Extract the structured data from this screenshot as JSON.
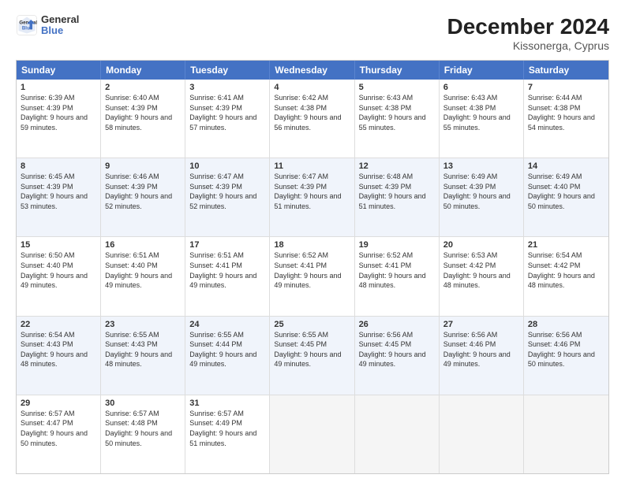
{
  "logo": {
    "line1": "General",
    "line2": "Blue"
  },
  "title": "December 2024",
  "subtitle": "Kissonerga, Cyprus",
  "days": [
    "Sunday",
    "Monday",
    "Tuesday",
    "Wednesday",
    "Thursday",
    "Friday",
    "Saturday"
  ],
  "weeks": [
    [
      {
        "num": "1",
        "sunrise": "6:39 AM",
        "sunset": "4:39 PM",
        "daylight": "9 hours and 59 minutes."
      },
      {
        "num": "2",
        "sunrise": "6:40 AM",
        "sunset": "4:39 PM",
        "daylight": "9 hours and 58 minutes."
      },
      {
        "num": "3",
        "sunrise": "6:41 AM",
        "sunset": "4:39 PM",
        "daylight": "9 hours and 57 minutes."
      },
      {
        "num": "4",
        "sunrise": "6:42 AM",
        "sunset": "4:38 PM",
        "daylight": "9 hours and 56 minutes."
      },
      {
        "num": "5",
        "sunrise": "6:43 AM",
        "sunset": "4:38 PM",
        "daylight": "9 hours and 55 minutes."
      },
      {
        "num": "6",
        "sunrise": "6:43 AM",
        "sunset": "4:38 PM",
        "daylight": "9 hours and 55 minutes."
      },
      {
        "num": "7",
        "sunrise": "6:44 AM",
        "sunset": "4:38 PM",
        "daylight": "9 hours and 54 minutes."
      }
    ],
    [
      {
        "num": "8",
        "sunrise": "6:45 AM",
        "sunset": "4:39 PM",
        "daylight": "9 hours and 53 minutes."
      },
      {
        "num": "9",
        "sunrise": "6:46 AM",
        "sunset": "4:39 PM",
        "daylight": "9 hours and 52 minutes."
      },
      {
        "num": "10",
        "sunrise": "6:47 AM",
        "sunset": "4:39 PM",
        "daylight": "9 hours and 52 minutes."
      },
      {
        "num": "11",
        "sunrise": "6:47 AM",
        "sunset": "4:39 PM",
        "daylight": "9 hours and 51 minutes."
      },
      {
        "num": "12",
        "sunrise": "6:48 AM",
        "sunset": "4:39 PM",
        "daylight": "9 hours and 51 minutes."
      },
      {
        "num": "13",
        "sunrise": "6:49 AM",
        "sunset": "4:39 PM",
        "daylight": "9 hours and 50 minutes."
      },
      {
        "num": "14",
        "sunrise": "6:49 AM",
        "sunset": "4:40 PM",
        "daylight": "9 hours and 50 minutes."
      }
    ],
    [
      {
        "num": "15",
        "sunrise": "6:50 AM",
        "sunset": "4:40 PM",
        "daylight": "9 hours and 49 minutes."
      },
      {
        "num": "16",
        "sunrise": "6:51 AM",
        "sunset": "4:40 PM",
        "daylight": "9 hours and 49 minutes."
      },
      {
        "num": "17",
        "sunrise": "6:51 AM",
        "sunset": "4:41 PM",
        "daylight": "9 hours and 49 minutes."
      },
      {
        "num": "18",
        "sunrise": "6:52 AM",
        "sunset": "4:41 PM",
        "daylight": "9 hours and 49 minutes."
      },
      {
        "num": "19",
        "sunrise": "6:52 AM",
        "sunset": "4:41 PM",
        "daylight": "9 hours and 48 minutes."
      },
      {
        "num": "20",
        "sunrise": "6:53 AM",
        "sunset": "4:42 PM",
        "daylight": "9 hours and 48 minutes."
      },
      {
        "num": "21",
        "sunrise": "6:54 AM",
        "sunset": "4:42 PM",
        "daylight": "9 hours and 48 minutes."
      }
    ],
    [
      {
        "num": "22",
        "sunrise": "6:54 AM",
        "sunset": "4:43 PM",
        "daylight": "9 hours and 48 minutes."
      },
      {
        "num": "23",
        "sunrise": "6:55 AM",
        "sunset": "4:43 PM",
        "daylight": "9 hours and 48 minutes."
      },
      {
        "num": "24",
        "sunrise": "6:55 AM",
        "sunset": "4:44 PM",
        "daylight": "9 hours and 49 minutes."
      },
      {
        "num": "25",
        "sunrise": "6:55 AM",
        "sunset": "4:45 PM",
        "daylight": "9 hours and 49 minutes."
      },
      {
        "num": "26",
        "sunrise": "6:56 AM",
        "sunset": "4:45 PM",
        "daylight": "9 hours and 49 minutes."
      },
      {
        "num": "27",
        "sunrise": "6:56 AM",
        "sunset": "4:46 PM",
        "daylight": "9 hours and 49 minutes."
      },
      {
        "num": "28",
        "sunrise": "6:56 AM",
        "sunset": "4:46 PM",
        "daylight": "9 hours and 50 minutes."
      }
    ],
    [
      {
        "num": "29",
        "sunrise": "6:57 AM",
        "sunset": "4:47 PM",
        "daylight": "9 hours and 50 minutes."
      },
      {
        "num": "30",
        "sunrise": "6:57 AM",
        "sunset": "4:48 PM",
        "daylight": "9 hours and 50 minutes."
      },
      {
        "num": "31",
        "sunrise": "6:57 AM",
        "sunset": "4:49 PM",
        "daylight": "9 hours and 51 minutes."
      },
      null,
      null,
      null,
      null
    ]
  ]
}
